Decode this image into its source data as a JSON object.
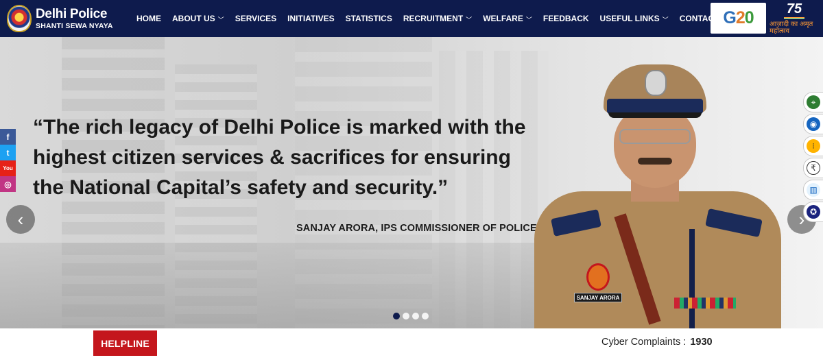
{
  "header": {
    "logo_title": "Delhi Police",
    "logo_subtitle": "SHANTI SEWA NYAYA",
    "nav": [
      {
        "label": "HOME",
        "dropdown": false
      },
      {
        "label": "ABOUT US",
        "dropdown": true
      },
      {
        "label": "SERVICES",
        "dropdown": false
      },
      {
        "label": "INITIATIVES",
        "dropdown": false
      },
      {
        "label": "STATISTICS",
        "dropdown": false
      },
      {
        "label": "RECRUITMENT",
        "dropdown": true
      },
      {
        "label": "WELFARE",
        "dropdown": true
      },
      {
        "label": "FEEDBACK",
        "dropdown": false
      },
      {
        "label": "USEFUL LINKS",
        "dropdown": true
      },
      {
        "label": "CONTACT US",
        "dropdown": true
      }
    ],
    "g20_logo_text": "G20",
    "azadi": {
      "number": "75",
      "text": "आज़ादी का अमृत महोत्सव"
    }
  },
  "hero": {
    "quote_lines": [
      "“The rich legacy of Delhi Police is marked with the",
      "highest citizen services & sacrifices for ensuring",
      "the National Capital’s safety and security.”"
    ],
    "author": "SANJAY ARORA, IPS COMMISSIONER OF POLICE",
    "nameplate": "SANJAY ARORA",
    "slide_count": 4,
    "active_slide": 1
  },
  "social": [
    {
      "name": "facebook",
      "glyph": "f"
    },
    {
      "name": "twitter",
      "glyph": "t"
    },
    {
      "name": "youtube",
      "glyph": "You"
    },
    {
      "name": "instagram",
      "glyph": "◎"
    }
  ],
  "service_icons": [
    "map-pin-icon",
    "globe-badge-icon",
    "traffic-light-icon",
    "rupee-icon",
    "chart-icon",
    "emblem-icon"
  ],
  "bottom": {
    "helpline_label": "HELPLINE",
    "cyber_label": "Cyber Complaints :",
    "cyber_number": "1930"
  },
  "colors": {
    "header_bg": "#0e1b4d",
    "helpline_bg": "#c4161c",
    "active_dot": "#0e1b4d"
  }
}
